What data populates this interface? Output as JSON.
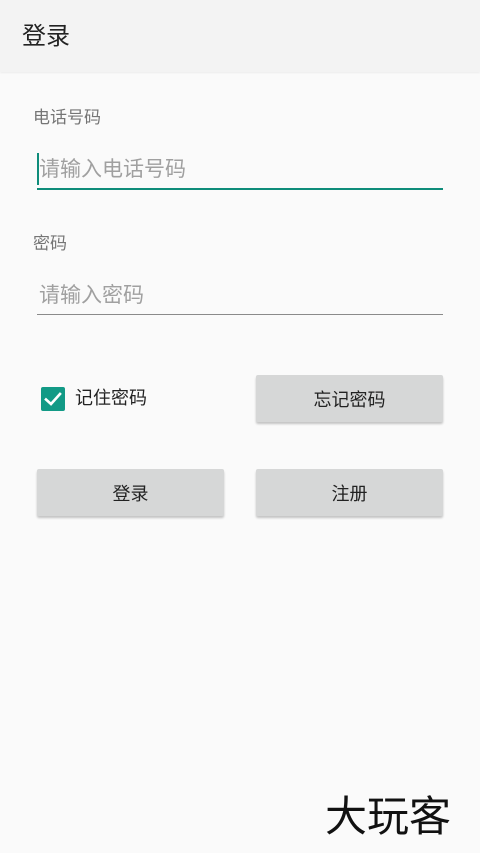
{
  "appbar": {
    "title": "登录"
  },
  "phone": {
    "label": "电话号码",
    "placeholder": "请输入电话号码",
    "value": ""
  },
  "password": {
    "label": "密码",
    "placeholder": "请输入密码",
    "value": ""
  },
  "remember": {
    "label": "记住密码",
    "checked": true
  },
  "buttons": {
    "forgot": "忘记密码",
    "login": "登录",
    "register": "注册"
  },
  "watermark": "大玩客",
  "colors": {
    "accent": "#0e8c7a",
    "checkbox": "#129a86",
    "button_bg": "#d6d7d7"
  }
}
